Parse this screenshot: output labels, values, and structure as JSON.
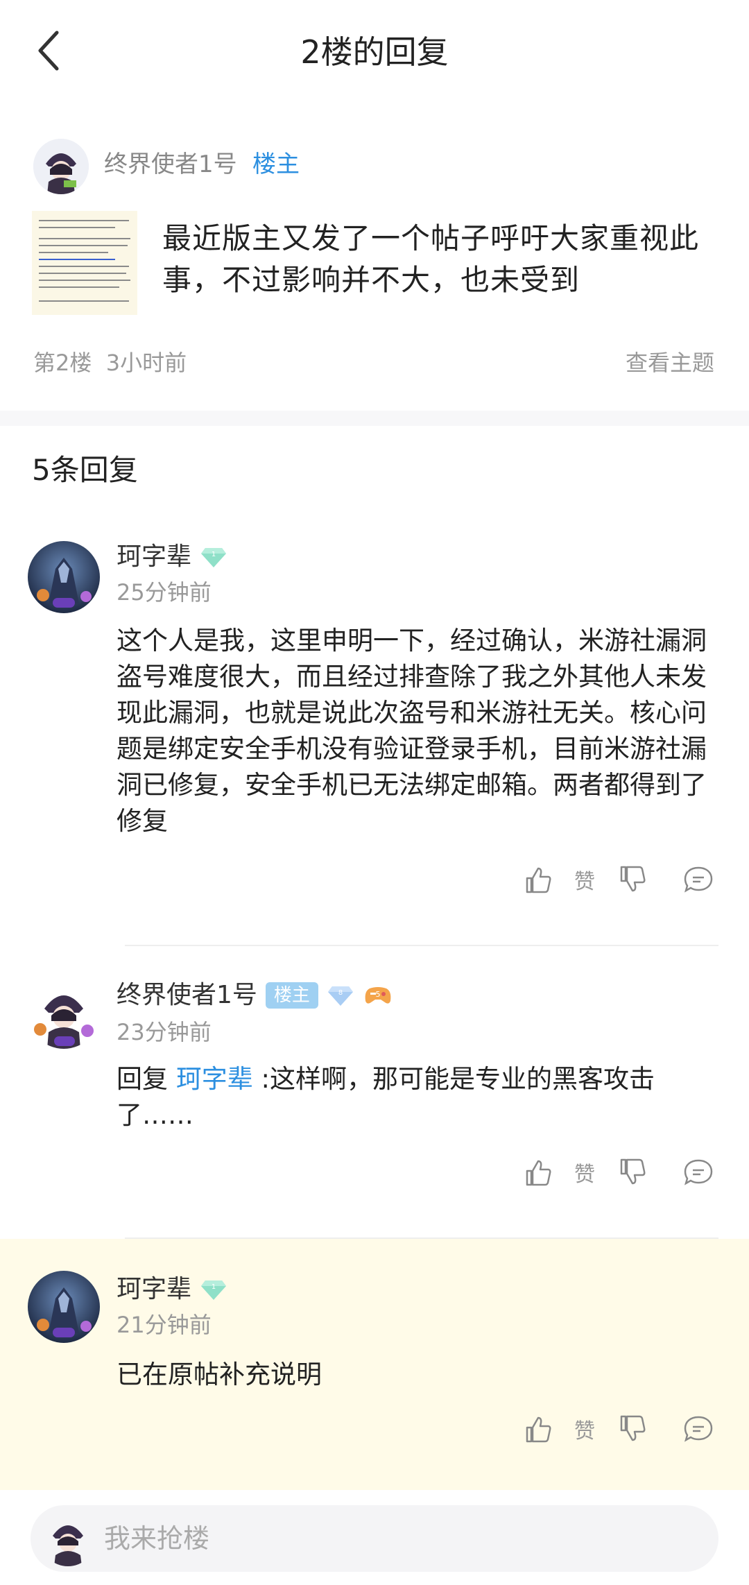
{
  "header": {
    "title": "2楼的回复"
  },
  "op": {
    "name": "终界使者1号",
    "tag": "楼主",
    "text": "最近版主又发了一个帖子呼吁大家重视此事，不过影响并不大，也未受到",
    "floor": "第2楼",
    "time": "3小时前",
    "view_topic": "查看主题"
  },
  "reply_count": "5条回复",
  "replies": [
    {
      "name": "珂字辈",
      "level": "1",
      "time": "25分钟前",
      "content": "这个人是我，这里申明一下，经过确认，米游社漏洞盗号难度很大，而且经过排查除了我之外其他人未发现此漏洞，也就是说此次盗号和米游社无关。核心问题是绑定安全手机没有验证登录手机，目前米游社漏洞已修复，安全手机已无法绑定邮箱。两者都得到了修复",
      "like_label": "赞"
    },
    {
      "name": "终界使者1号",
      "host_badge": "楼主",
      "level": "8",
      "extra_badge": "5",
      "time": "23分钟前",
      "reply_prefix": "回复 ",
      "mention": "珂字辈",
      "content": " :这样啊，那可能是专业的黑客攻击了……",
      "like_label": "赞"
    },
    {
      "name": "珂字辈",
      "level": "1",
      "time": "21分钟前",
      "content": "已在原帖补充说明",
      "like_label": "赞"
    }
  ],
  "input": {
    "placeholder": "我来抢楼"
  },
  "colors": {
    "accent": "#2c8fe0",
    "highlight": "#fffbe8",
    "gem": "#7fdcc4",
    "gem_blue": "#9ec8f2"
  }
}
